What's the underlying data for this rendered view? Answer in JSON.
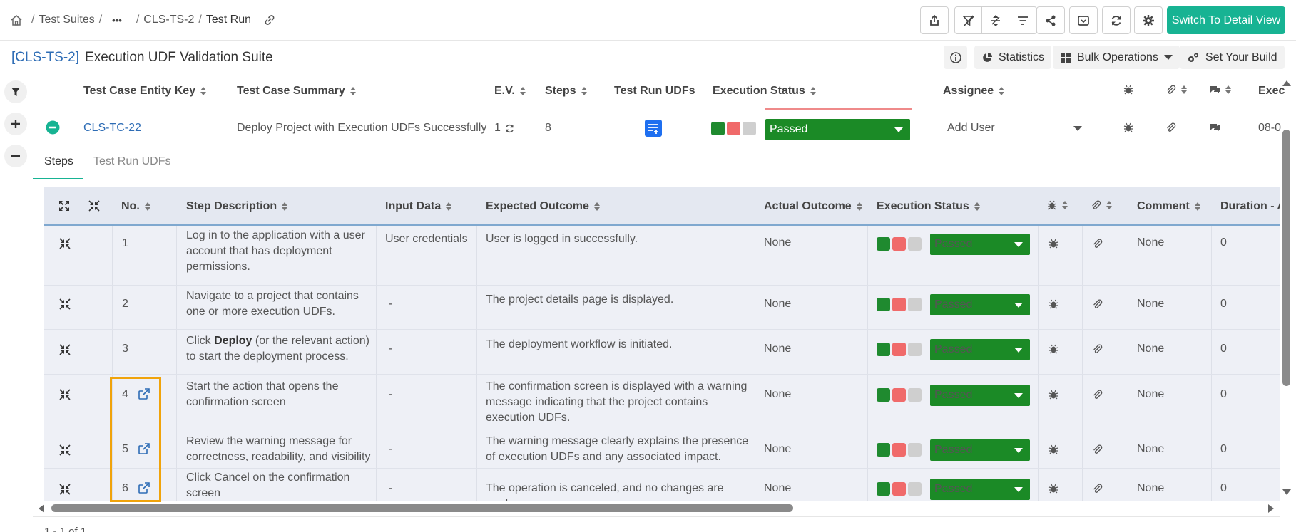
{
  "breadcrumb": {
    "items": [
      "Test Suites",
      "CLS-TS-2",
      "Test Run"
    ],
    "ellipsis": "•••",
    "sep": "/"
  },
  "toolbar": {
    "primary_label": "Switch To Detail View"
  },
  "suite": {
    "key": "[CLS-TS-2]",
    "name": "Execution UDF Validation Suite"
  },
  "actions": {
    "statistics": "Statistics",
    "bulk_operations": "Bulk Operations",
    "set_build": "Set Your Build"
  },
  "columns": {
    "entity_key": "Test Case Entity Key",
    "summary": "Test Case Summary",
    "ev": "E.V.",
    "steps": "Steps",
    "udfs": "Test Run UDFs",
    "status": "Execution Status",
    "assignee": "Assignee",
    "exec": "Exec"
  },
  "test_case": {
    "key": "CLS-TC-22",
    "summary": "Deploy Project with Execution UDFs Successfully",
    "ev": "1",
    "steps": "8",
    "status": "Passed",
    "assignee": "Add User",
    "exec_date": "08-0"
  },
  "subtabs": {
    "steps": "Steps",
    "udfs": "Test Run UDFs"
  },
  "step_columns": {
    "no": "No.",
    "description": "Step Description",
    "input": "Input Data",
    "expected": "Expected Outcome",
    "actual": "Actual Outcome",
    "status": "Execution Status",
    "comment": "Comment",
    "duration": "Duration - A"
  },
  "steps": [
    {
      "no": "1",
      "desc_lines": [
        "Log in to the application with a user",
        "account that has deployment",
        "permissions."
      ],
      "input": "User credentials",
      "expected_lines": [
        "User is logged in successfully."
      ],
      "actual": "None",
      "status": "Passed",
      "comment": "None",
      "duration": "0"
    },
    {
      "no": "2",
      "desc_lines": [
        "Navigate to a project that contains",
        "one or more execution UDFs."
      ],
      "input": "-",
      "expected_lines": [
        "The project details page is displayed."
      ],
      "actual": "None",
      "status": "Passed",
      "comment": "None",
      "duration": "0"
    },
    {
      "no": "3",
      "desc_pre": "Click ",
      "desc_bold": "Deploy",
      "desc_post": " (or the relevant action)",
      "desc_line2": "to start the deployment process.",
      "input": "-",
      "expected_lines": [
        "The deployment workflow is initiated."
      ],
      "actual": "None",
      "status": "Passed",
      "comment": "None",
      "duration": "0"
    },
    {
      "no": "4",
      "desc_lines": [
        "Start the action that opens the",
        "confirmation screen"
      ],
      "input": "-",
      "expected_lines": [
        "The confirmation screen is displayed with a warning",
        "message indicating that the project contains",
        "execution UDFs."
      ],
      "actual": "None",
      "status": "Passed",
      "comment": "None",
      "duration": "0"
    },
    {
      "no": "5",
      "desc_lines": [
        "Review the warning message for",
        "correctness, readability, and visibility"
      ],
      "input": "-",
      "expected_lines": [
        "The warning message clearly explains the presence",
        "of execution UDFs and any associated impact."
      ],
      "actual": "None",
      "status": "Passed",
      "comment": "None",
      "duration": "0"
    },
    {
      "no": "6",
      "desc_lines": [
        "Click Cancel on the confirmation",
        "screen"
      ],
      "input": "-",
      "expected_lines": [
        "The operation is canceled, and no changes are made."
      ],
      "actual": "None",
      "status": "Passed",
      "comment": "None",
      "duration": "0"
    }
  ],
  "pagination": "1 - 1 of 1",
  "colors": {
    "accent": "#17b393",
    "link": "#2d6cb5",
    "passed": "#1b8a26",
    "fail": "#f06a6a",
    "highlight": "#f0a30a"
  },
  "icons": {
    "home": "home-icon",
    "link": "link-icon",
    "bug": "bug-icon",
    "attachment": "paperclip-icon",
    "comment": "comment-icon",
    "open": "external-link-icon"
  }
}
